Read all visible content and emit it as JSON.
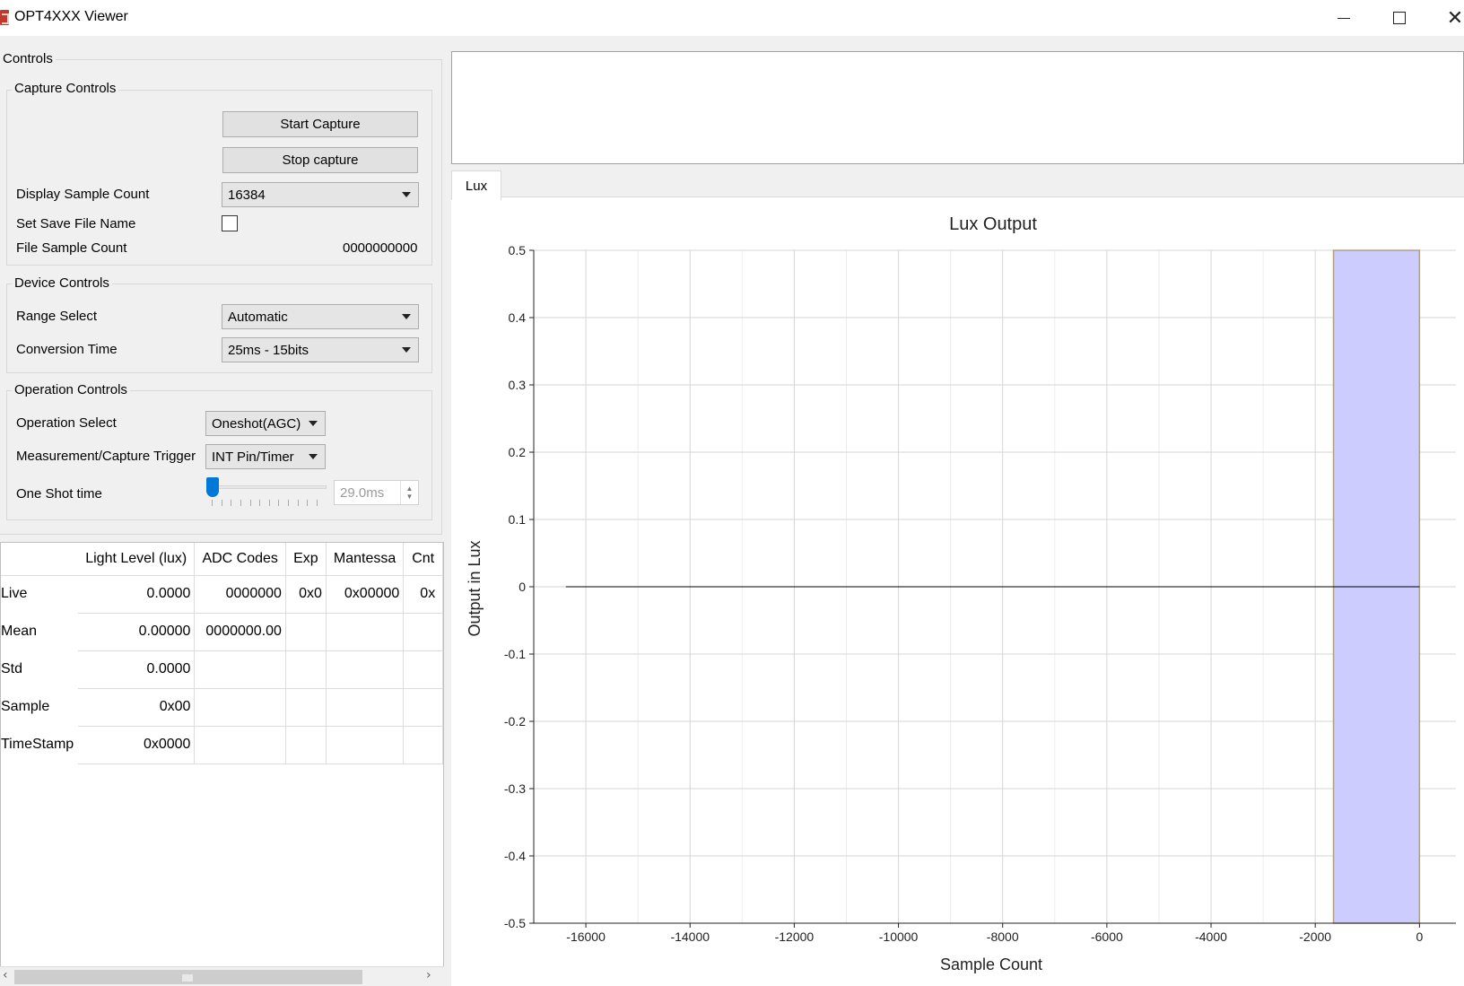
{
  "window": {
    "title": "OPT4XXX Viewer"
  },
  "controls": {
    "title": "Controls",
    "capture": {
      "title": "Capture Controls",
      "start_label": "Start Capture",
      "stop_label": "Stop capture",
      "display_sample_count_label": "Display Sample Count",
      "display_sample_count_value": "16384",
      "set_save_file_label": "Set Save File Name",
      "file_sample_count_label": "File Sample Count",
      "file_sample_count_value": "0000000000"
    },
    "device": {
      "title": "Device Controls",
      "range_select_label": "Range Select",
      "range_select_value": "Automatic",
      "conversion_time_label": "Conversion Time",
      "conversion_time_value": "25ms - 15bits"
    },
    "operation": {
      "title": "Operation Controls",
      "operation_select_label": "Operation Select",
      "operation_select_value": "Oneshot(AGC)",
      "trigger_label": "Measurement/Capture Trigger",
      "trigger_value": "INT Pin/Timer",
      "one_shot_label": "One Shot time",
      "one_shot_value": "29.0ms",
      "one_shot_slider_fraction": 0.0
    }
  },
  "table": {
    "columns": [
      "Light Level (lux)",
      "ADC Codes",
      "Exp",
      "Mantessa",
      "Cnt"
    ],
    "rows": [
      {
        "label": "Live",
        "cells": [
          "0.0000",
          "0000000",
          "0x0",
          "0x00000",
          "0x"
        ]
      },
      {
        "label": "Mean",
        "cells": [
          "0.00000",
          "0000000.00",
          "",
          "",
          ""
        ]
      },
      {
        "label": "Std",
        "cells": [
          "0.0000",
          "",
          "",
          "",
          ""
        ]
      },
      {
        "label": "Sample",
        "cells": [
          "0x00",
          "",
          "",
          "",
          ""
        ]
      },
      {
        "label": "TimeStamp",
        "cells": [
          "0x0000",
          "",
          "",
          "",
          ""
        ]
      }
    ]
  },
  "tabs": {
    "lux": "Lux"
  },
  "chart_data": {
    "type": "line",
    "title": "Lux Output",
    "xlabel": "Sample Count",
    "ylabel": "Output in Lux",
    "xlim": [
      -17000,
      700
    ],
    "ylim": [
      -0.5,
      0.5
    ],
    "xticks": [
      -16000,
      -14000,
      -12000,
      -10000,
      -8000,
      -6000,
      -4000,
      -2000,
      0
    ],
    "yticks": [
      0.5,
      0.4,
      0.3,
      0.2,
      0.1,
      0,
      -0.1,
      -0.2,
      -0.3,
      -0.4,
      -0.5
    ],
    "grid": true,
    "series": [
      {
        "x": [
          -16384,
          0
        ],
        "y": [
          0,
          0
        ],
        "color": "#000000"
      }
    ],
    "highlight_region": {
      "x_start": -1650,
      "x_end": 0,
      "color": "#ccccff"
    }
  }
}
